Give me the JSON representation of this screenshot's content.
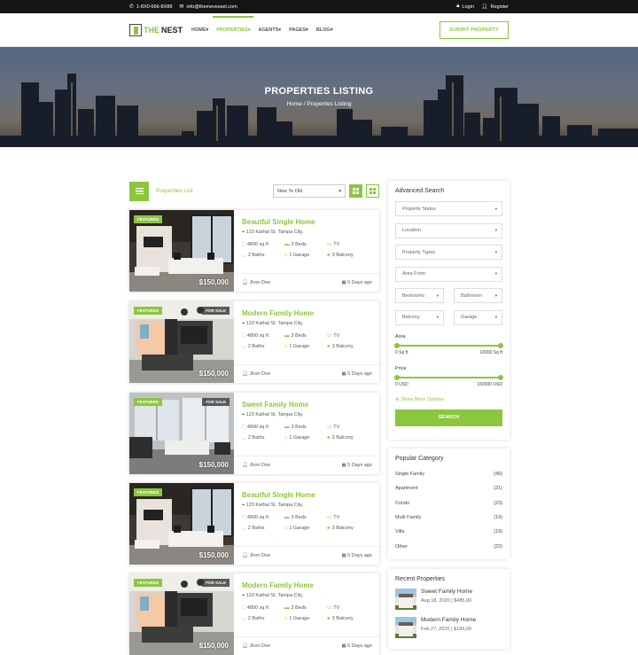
{
  "topbar": {
    "phone": "1-8X0-666-8X88",
    "email": "info@themevessel.com",
    "login": "Login",
    "register": "Register"
  },
  "nav": {
    "logo_the": "THE",
    "logo_nest": "NEST",
    "items": [
      "HOME",
      "PROPERTIES",
      "AGENTS",
      "PAGES",
      "BLOG"
    ],
    "submit": "SUBMIT PROPERTY"
  },
  "hero": {
    "title": "PROPERTIES LISTING",
    "crumb_home": "Home",
    "crumb_sep": "/",
    "crumb_current": "Properties Listing"
  },
  "list": {
    "label": "Properties List",
    "sort_value": "New To Old",
    "properties": [
      {
        "title": "Beautful Single Home",
        "address": "123 Kathal St. Tampa City,",
        "area": "4800 sq ft",
        "beds": "3 Beds",
        "tv": "TV",
        "baths": "2 Baths",
        "garage": "1 Garage",
        "balcony": "3 Balcony",
        "agent": "Jhon Doe",
        "age": "5 Days ago",
        "price": "$150,000",
        "featured": "FEATURED",
        "sale": ""
      },
      {
        "title": "Modern Family Home",
        "address": "123 Kathal St. Tampa City,",
        "area": "4800 sq ft",
        "beds": "3 Beds",
        "tv": "TV",
        "baths": "2 Baths",
        "garage": "1 Garage",
        "balcony": "3 Balcony",
        "agent": "Jhon Doe",
        "age": "5 Days ago",
        "price": "$150,000",
        "featured": "FEATURED",
        "sale": "FOR SALE"
      },
      {
        "title": "Sweet Family Home",
        "address": "123 Kathal St. Tampa City,",
        "area": "4800 sq ft",
        "beds": "3 Beds",
        "tv": "TV",
        "baths": "2 Baths",
        "garage": "1 Garage",
        "balcony": "3 Balcony",
        "agent": "Jhon Doe",
        "age": "5 Days ago",
        "price": "$150,000",
        "featured": "FEATURED",
        "sale": "FOR SALE"
      },
      {
        "title": "Beautful Single Home",
        "address": "123 Kathal St. Tampa City,",
        "area": "4800 sq ft",
        "beds": "3 Beds",
        "tv": "TV",
        "baths": "2 Baths",
        "garage": "1 Garage",
        "balcony": "3 Balcony",
        "agent": "Jhon Doe",
        "age": "5 Days ago",
        "price": "$150,000",
        "featured": "FEATURED",
        "sale": ""
      },
      {
        "title": "Modern Family Home",
        "address": "123 Kathal St. Tampa City,",
        "area": "4800 sq ft",
        "beds": "3 Beds",
        "tv": "TV",
        "baths": "2 Baths",
        "garage": "1 Garage",
        "balcony": "3 Balcony",
        "agent": "Jhon Doe",
        "age": "5 Days ago",
        "price": "$150,000",
        "featured": "FEATURED",
        "sale": "FOR SALE"
      }
    ]
  },
  "search": {
    "title": "Advanced Search",
    "status": "Property Status",
    "location": "Location",
    "type": "Property Types",
    "area_from": "Area From",
    "bedrooms": "Bedrooms",
    "bathroom": "Bathroom",
    "balcony": "Balcony",
    "garage": "Garage",
    "area_label": "Area",
    "area_min": "0 Sq ft",
    "area_max": "10000 Sq ft",
    "price_label": "Price",
    "price_min": "0 USD",
    "price_max": "150000 USD",
    "more": "Show More Options",
    "button": "SEARCH"
  },
  "categories": {
    "title": "Popular Category",
    "items": [
      {
        "name": "Single Family",
        "count": "(45)"
      },
      {
        "name": "Apartment",
        "count": "(21)"
      },
      {
        "name": "Condo",
        "count": "(23)"
      },
      {
        "name": "Multi Family",
        "count": "(19)"
      },
      {
        "name": "Villa",
        "count": "(19)"
      },
      {
        "name": "Other",
        "count": "(22)"
      }
    ]
  },
  "recent": {
    "title": "Recent Properties",
    "items": [
      {
        "name": "Sweet Family Home",
        "meta": "Aug 18, 2020 | $485,00"
      },
      {
        "name": "Modern Family Home",
        "meta": "Feb 27, 2020 | $199,00"
      }
    ]
  },
  "colors": {
    "accent": "#8cc63e",
    "topbar": "#151515"
  }
}
